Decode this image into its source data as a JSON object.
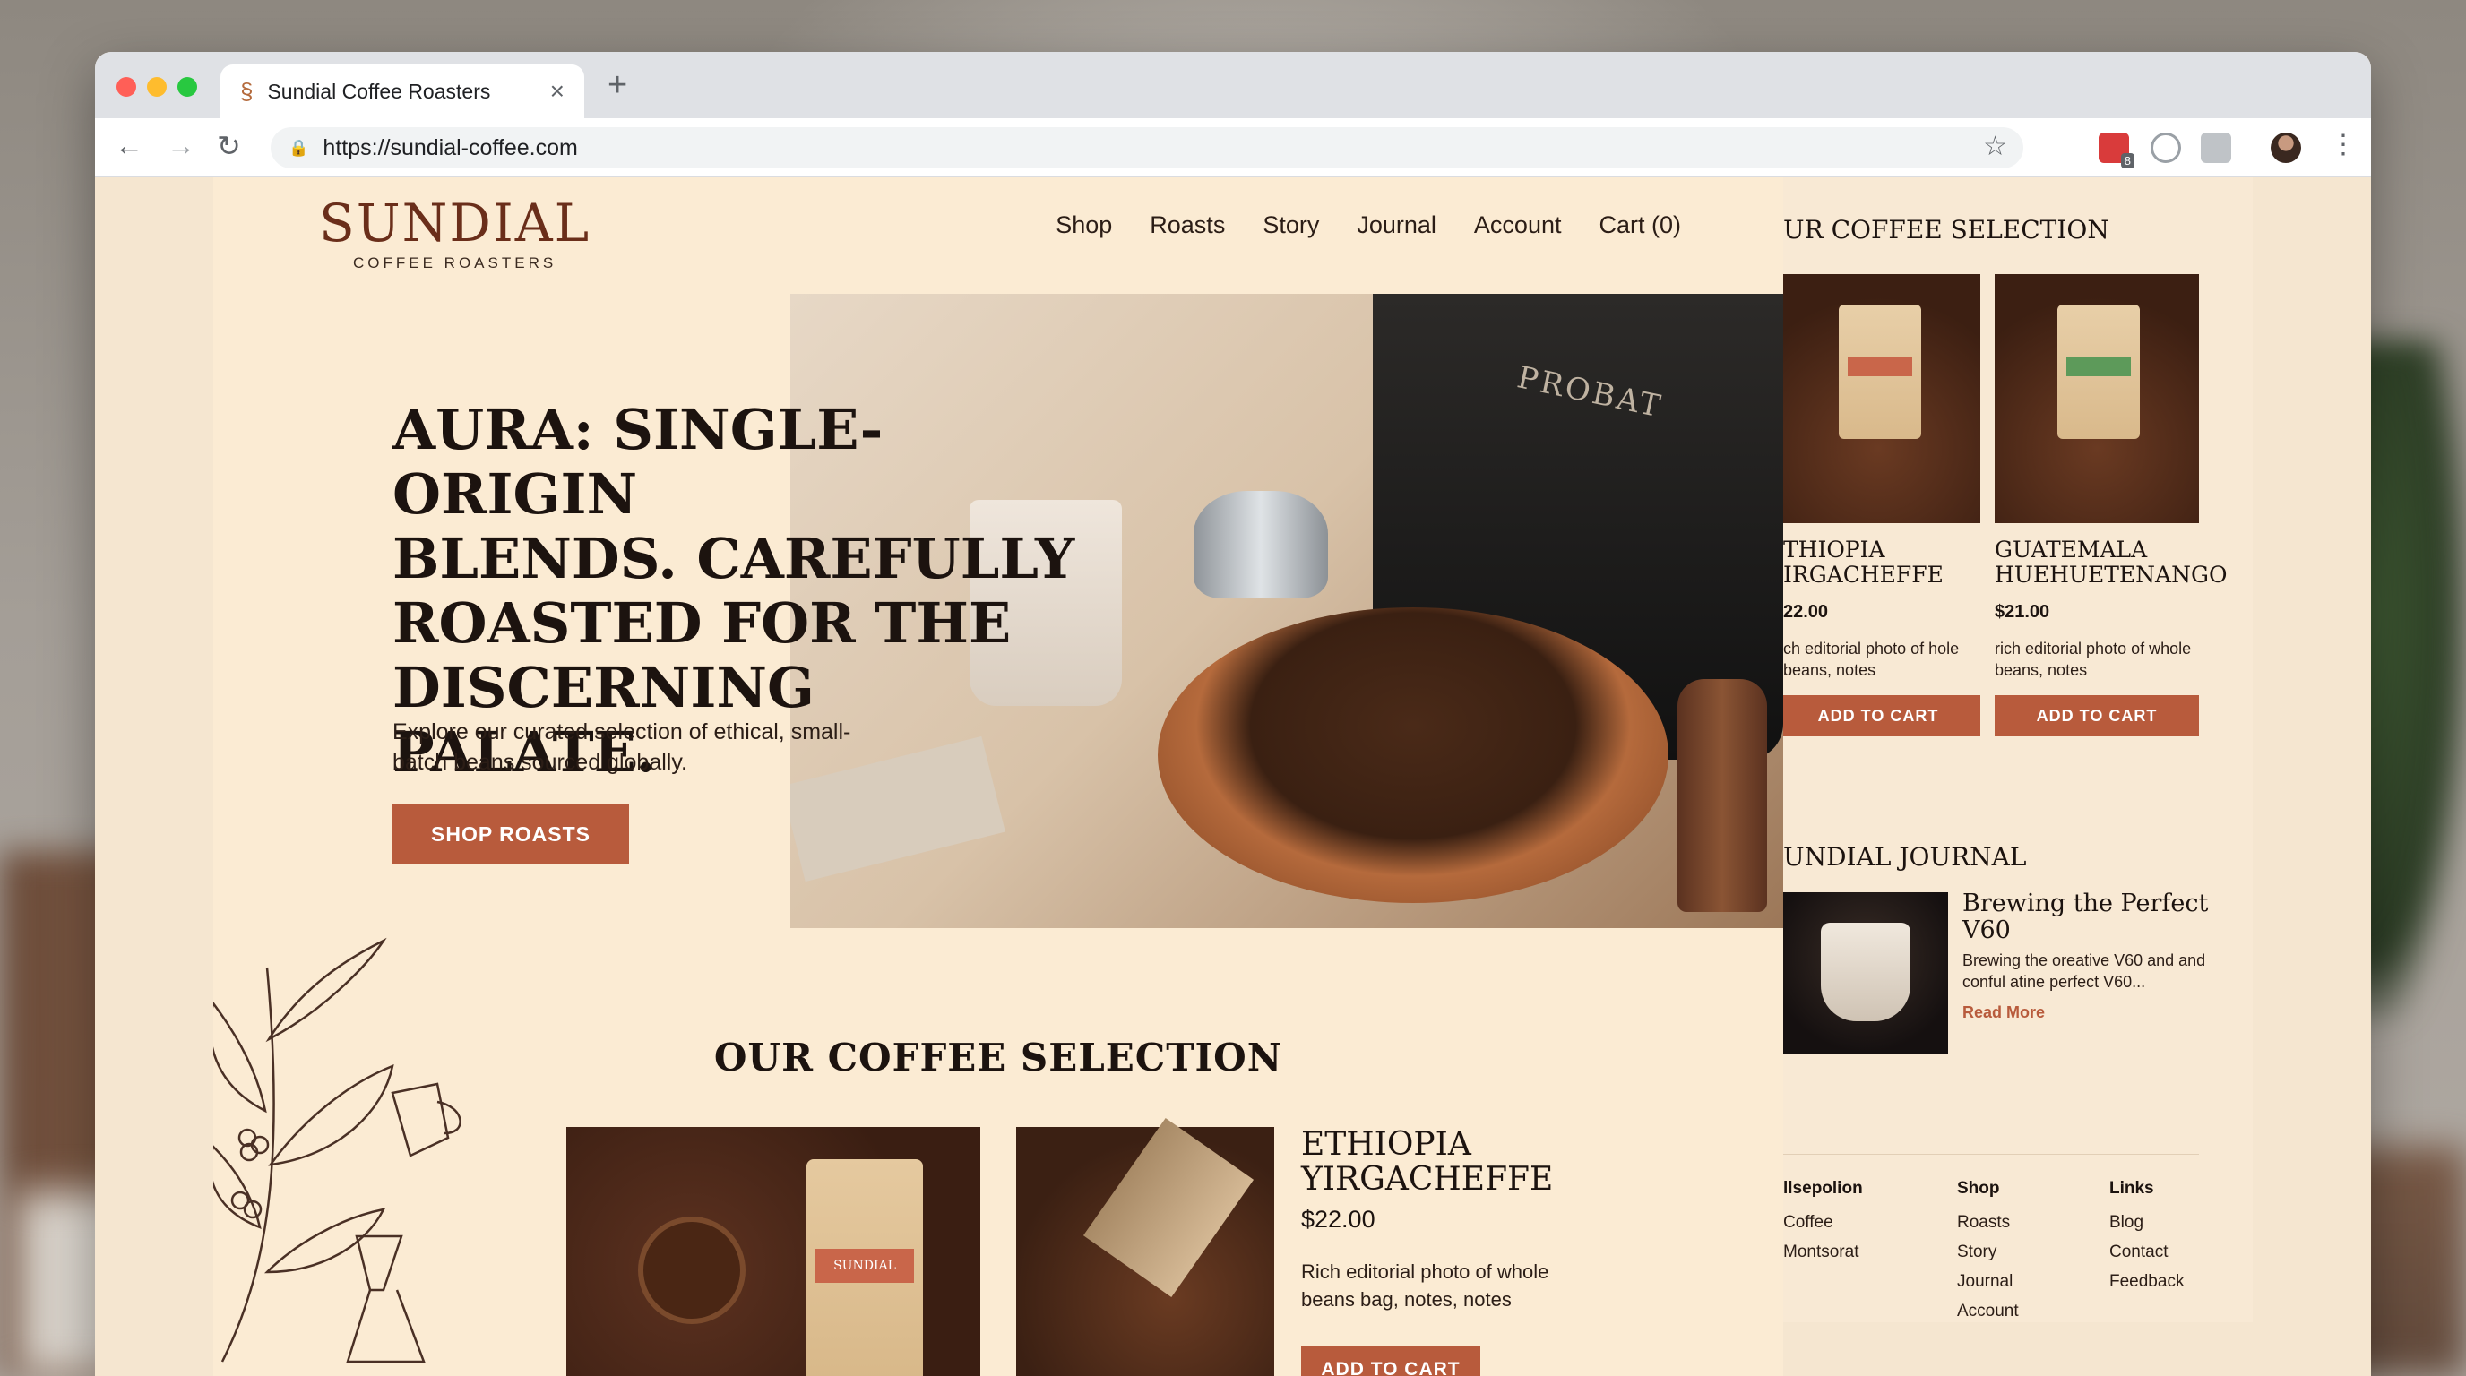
{
  "browser": {
    "tab_title": "Sundial Coffee Roasters",
    "favicon": "sundial-swirl-icon",
    "url": "https://sundial-coffee.com",
    "extension_badge": "8",
    "colors": {
      "close": "#ff5f57",
      "minimize": "#febc2e",
      "maximize": "#28c840"
    }
  },
  "site": {
    "logo": {
      "name": "SUNDIAL",
      "tagline": "COFFEE ROASTERS"
    },
    "nav": [
      "Shop",
      "Roasts",
      "Story",
      "Journal",
      "Account",
      "Cart (0)"
    ],
    "hero": {
      "title_lines": [
        "AURA: SINGLE-ORIGIN",
        "BLENDS. CAREFULLY",
        "ROASTED FOR THE",
        "DISCERNING PALATE."
      ],
      "subtitle": "Explore our curated selection of ethical, small-batch beans sourced globally.",
      "cta": "SHOP ROASTS",
      "machine_label": "PROBAT"
    },
    "selection": {
      "heading": "OUR COFFEE SELECTION",
      "bag_label": "SUNDIAL",
      "product": {
        "name_lines": [
          "ETHIOPIA",
          "YIRGACHEFFE"
        ],
        "price": "$22.00",
        "description": "Rich editorial photo of whole beans bag, notes, notes",
        "cta": "ADD TO CART"
      }
    },
    "side_panel": {
      "heading": "UR COFFEE SELECTION",
      "products": [
        {
          "name_lines": [
            "THIOPIA",
            "IRGACHEFFE"
          ],
          "price": "22.00",
          "description": "ch editorial photo of hole beans, notes",
          "cta": "ADD TO CART",
          "label_color": "#c9664a"
        },
        {
          "name_lines": [
            "GUATEMALA",
            "HUEHUETENANGO"
          ],
          "price": "$21.00",
          "description": "rich editorial photo of whole  beans, notes",
          "cta": "ADD TO CART",
          "label_color": "#5d9a5a"
        }
      ],
      "journal": {
        "heading": "UNDIAL JOURNAL",
        "title": "Brewing the Perfect V60",
        "excerpt": "Brewing the oreative V60 and and conful atine perfect V60...",
        "read_more": "Read More"
      },
      "footer": {
        "columns": [
          {
            "heading": "llsepolion",
            "items": [
              "Coffee",
              "Montsorat"
            ]
          },
          {
            "heading": "Shop",
            "items": [
              "Roasts",
              "Story",
              "Journal",
              "Account"
            ]
          },
          {
            "heading": "Links",
            "items": [
              "Blog",
              "Contact",
              "Feedback"
            ]
          }
        ]
      }
    }
  }
}
